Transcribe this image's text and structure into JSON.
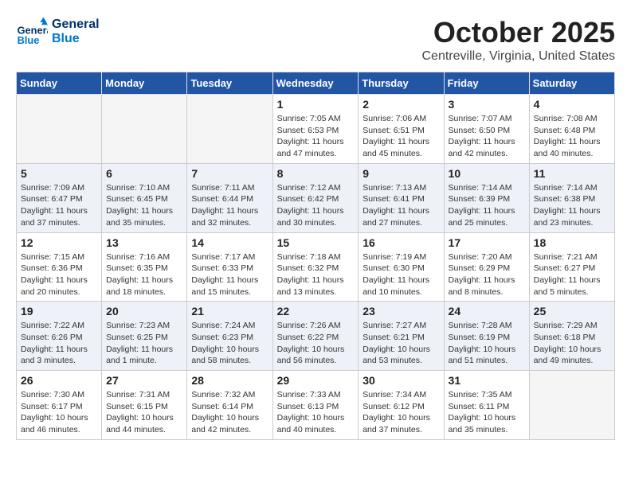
{
  "header": {
    "logo_text1": "General",
    "logo_text2": "Blue",
    "month": "October 2025",
    "location": "Centreville, Virginia, United States"
  },
  "days_of_week": [
    "Sunday",
    "Monday",
    "Tuesday",
    "Wednesday",
    "Thursday",
    "Friday",
    "Saturday"
  ],
  "weeks": [
    [
      {
        "day": "",
        "info": ""
      },
      {
        "day": "",
        "info": ""
      },
      {
        "day": "",
        "info": ""
      },
      {
        "day": "1",
        "info": "Sunrise: 7:05 AM\nSunset: 6:53 PM\nDaylight: 11 hours\nand 47 minutes."
      },
      {
        "day": "2",
        "info": "Sunrise: 7:06 AM\nSunset: 6:51 PM\nDaylight: 11 hours\nand 45 minutes."
      },
      {
        "day": "3",
        "info": "Sunrise: 7:07 AM\nSunset: 6:50 PM\nDaylight: 11 hours\nand 42 minutes."
      },
      {
        "day": "4",
        "info": "Sunrise: 7:08 AM\nSunset: 6:48 PM\nDaylight: 11 hours\nand 40 minutes."
      }
    ],
    [
      {
        "day": "5",
        "info": "Sunrise: 7:09 AM\nSunset: 6:47 PM\nDaylight: 11 hours\nand 37 minutes."
      },
      {
        "day": "6",
        "info": "Sunrise: 7:10 AM\nSunset: 6:45 PM\nDaylight: 11 hours\nand 35 minutes."
      },
      {
        "day": "7",
        "info": "Sunrise: 7:11 AM\nSunset: 6:44 PM\nDaylight: 11 hours\nand 32 minutes."
      },
      {
        "day": "8",
        "info": "Sunrise: 7:12 AM\nSunset: 6:42 PM\nDaylight: 11 hours\nand 30 minutes."
      },
      {
        "day": "9",
        "info": "Sunrise: 7:13 AM\nSunset: 6:41 PM\nDaylight: 11 hours\nand 27 minutes."
      },
      {
        "day": "10",
        "info": "Sunrise: 7:14 AM\nSunset: 6:39 PM\nDaylight: 11 hours\nand 25 minutes."
      },
      {
        "day": "11",
        "info": "Sunrise: 7:14 AM\nSunset: 6:38 PM\nDaylight: 11 hours\nand 23 minutes."
      }
    ],
    [
      {
        "day": "12",
        "info": "Sunrise: 7:15 AM\nSunset: 6:36 PM\nDaylight: 11 hours\nand 20 minutes."
      },
      {
        "day": "13",
        "info": "Sunrise: 7:16 AM\nSunset: 6:35 PM\nDaylight: 11 hours\nand 18 minutes."
      },
      {
        "day": "14",
        "info": "Sunrise: 7:17 AM\nSunset: 6:33 PM\nDaylight: 11 hours\nand 15 minutes."
      },
      {
        "day": "15",
        "info": "Sunrise: 7:18 AM\nSunset: 6:32 PM\nDaylight: 11 hours\nand 13 minutes."
      },
      {
        "day": "16",
        "info": "Sunrise: 7:19 AM\nSunset: 6:30 PM\nDaylight: 11 hours\nand 10 minutes."
      },
      {
        "day": "17",
        "info": "Sunrise: 7:20 AM\nSunset: 6:29 PM\nDaylight: 11 hours\nand 8 minutes."
      },
      {
        "day": "18",
        "info": "Sunrise: 7:21 AM\nSunset: 6:27 PM\nDaylight: 11 hours\nand 5 minutes."
      }
    ],
    [
      {
        "day": "19",
        "info": "Sunrise: 7:22 AM\nSunset: 6:26 PM\nDaylight: 11 hours\nand 3 minutes."
      },
      {
        "day": "20",
        "info": "Sunrise: 7:23 AM\nSunset: 6:25 PM\nDaylight: 11 hours\nand 1 minute."
      },
      {
        "day": "21",
        "info": "Sunrise: 7:24 AM\nSunset: 6:23 PM\nDaylight: 10 hours\nand 58 minutes."
      },
      {
        "day": "22",
        "info": "Sunrise: 7:26 AM\nSunset: 6:22 PM\nDaylight: 10 hours\nand 56 minutes."
      },
      {
        "day": "23",
        "info": "Sunrise: 7:27 AM\nSunset: 6:21 PM\nDaylight: 10 hours\nand 53 minutes."
      },
      {
        "day": "24",
        "info": "Sunrise: 7:28 AM\nSunset: 6:19 PM\nDaylight: 10 hours\nand 51 minutes."
      },
      {
        "day": "25",
        "info": "Sunrise: 7:29 AM\nSunset: 6:18 PM\nDaylight: 10 hours\nand 49 minutes."
      }
    ],
    [
      {
        "day": "26",
        "info": "Sunrise: 7:30 AM\nSunset: 6:17 PM\nDaylight: 10 hours\nand 46 minutes."
      },
      {
        "day": "27",
        "info": "Sunrise: 7:31 AM\nSunset: 6:15 PM\nDaylight: 10 hours\nand 44 minutes."
      },
      {
        "day": "28",
        "info": "Sunrise: 7:32 AM\nSunset: 6:14 PM\nDaylight: 10 hours\nand 42 minutes."
      },
      {
        "day": "29",
        "info": "Sunrise: 7:33 AM\nSunset: 6:13 PM\nDaylight: 10 hours\nand 40 minutes."
      },
      {
        "day": "30",
        "info": "Sunrise: 7:34 AM\nSunset: 6:12 PM\nDaylight: 10 hours\nand 37 minutes."
      },
      {
        "day": "31",
        "info": "Sunrise: 7:35 AM\nSunset: 6:11 PM\nDaylight: 10 hours\nand 35 minutes."
      },
      {
        "day": "",
        "info": ""
      }
    ]
  ]
}
